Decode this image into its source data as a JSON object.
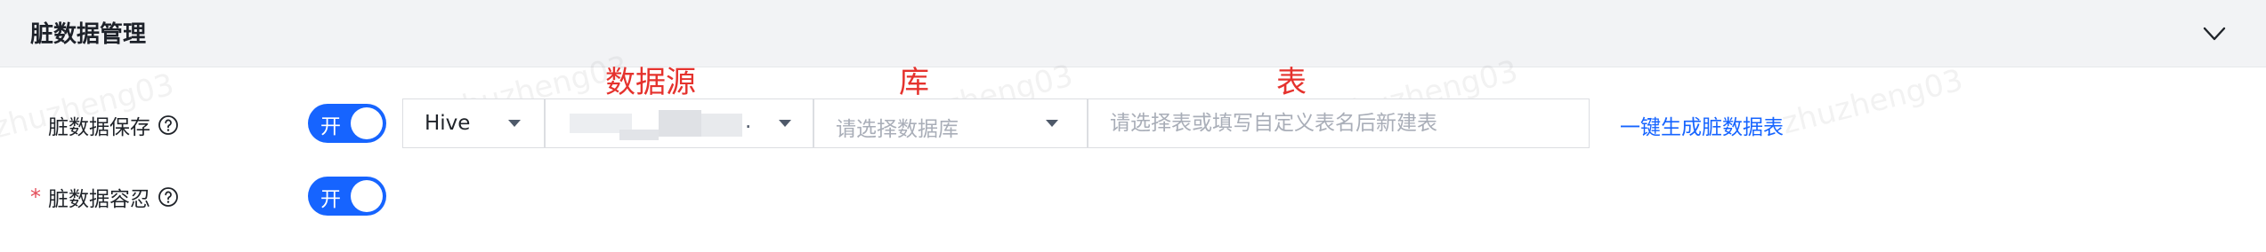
{
  "section": {
    "title": "脏数据管理"
  },
  "watermark": {
    "text": "zhuzheng03"
  },
  "annotations": {
    "datasource": "数据源",
    "database": "库",
    "table": "表"
  },
  "rows": {
    "save": {
      "label": "脏数据保存",
      "switch_label": "开"
    },
    "tolerate": {
      "required_mark": "*",
      "label": "脏数据容忍",
      "switch_label": "开"
    }
  },
  "selects": {
    "engine": {
      "value": "Hive"
    },
    "datasource": {
      "value_suffix": "."
    },
    "database": {
      "placeholder": "请选择数据库"
    }
  },
  "table_input": {
    "placeholder": "请选择表或填写自定义表名后新建表"
  },
  "generate_link": {
    "label": "一键生成脏数据表"
  },
  "colors": {
    "primary": "#1664ff",
    "annotation": "#e5322d",
    "required": "#e34d59"
  }
}
